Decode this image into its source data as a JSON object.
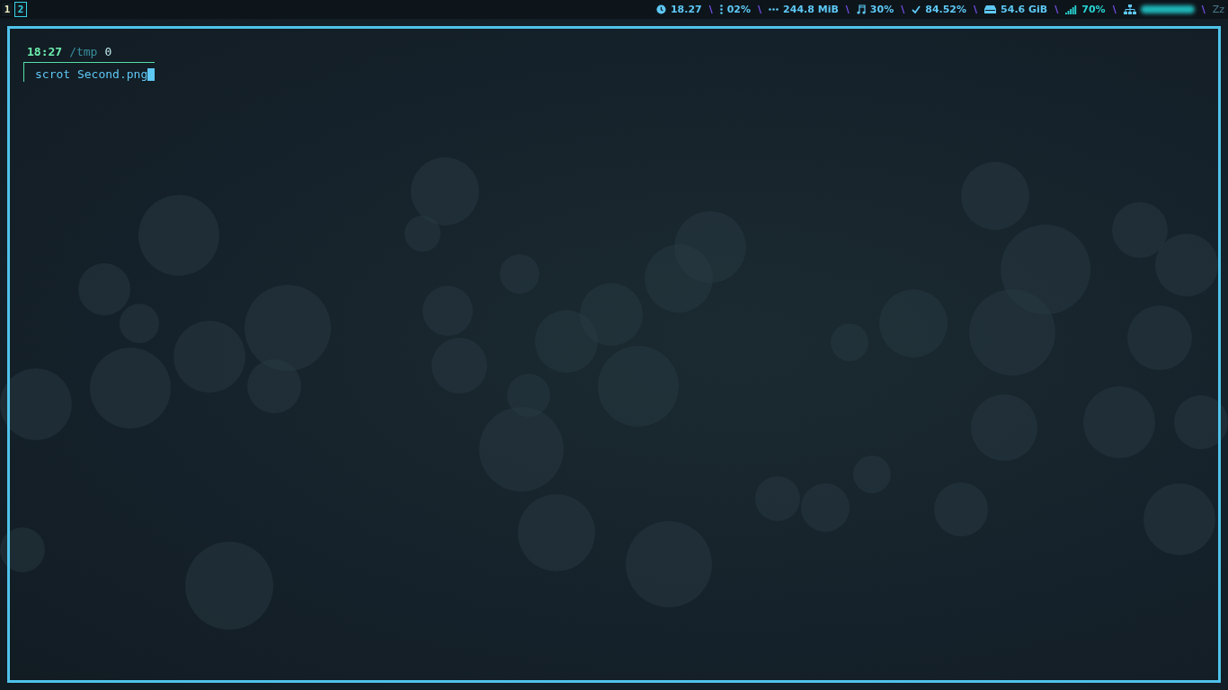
{
  "workspaces": [
    {
      "label": "1",
      "selected": false
    },
    {
      "label": "2",
      "selected": true
    }
  ],
  "status": [
    {
      "kind": "clock",
      "text": "18.27"
    },
    {
      "kind": "cpu",
      "text": "02%"
    },
    {
      "kind": "memory",
      "text": "244.8 MiB"
    },
    {
      "kind": "volume",
      "text": "30%"
    },
    {
      "kind": "battery",
      "text": "84.52%"
    },
    {
      "kind": "disk",
      "text": "54.6 GiB"
    },
    {
      "kind": "wifi",
      "text": "70%"
    },
    {
      "kind": "network"
    }
  ],
  "separator": "\\",
  "idle": "Zz",
  "terminal": {
    "time": "18:27",
    "path": "/tmp",
    "code": "0",
    "command": "scrot Second.png"
  }
}
